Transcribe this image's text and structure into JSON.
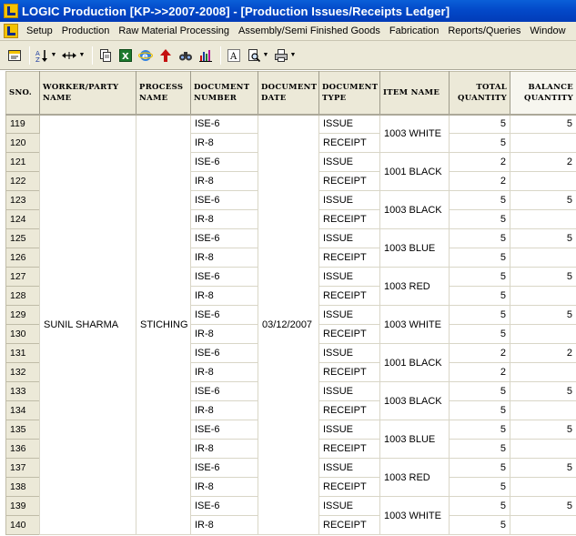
{
  "window": {
    "title": "LOGIC Production  [KP->>2007-2008] - [Production Issues/Receipts Ledger]"
  },
  "menu": {
    "items": [
      "Setup",
      "Production",
      "Raw Material Processing",
      "Assembly/Semi Finished Goods",
      "Fabrication",
      "Reports/Queries",
      "Window"
    ]
  },
  "toolbar": {
    "icons": [
      "form-icon",
      "sort-icon",
      "column-width-icon",
      "copy-icon",
      "excel-icon",
      "browser-icon",
      "upload-arrow-icon",
      "find-icon",
      "chart-icon",
      "font-icon",
      "print-preview-icon",
      "printer-icon"
    ]
  },
  "table": {
    "headers": {
      "sno": "SNO.",
      "worker": "WORKER/PARTY NAME",
      "process": "PROCESS NAME",
      "doc_number": "DOCUMENT NUMBER",
      "doc_date": "DOCUMENT DATE",
      "doc_type": "DOCUMENT TYPE",
      "item_name": "ITEM NAME",
      "total_qty": "TOTAL QUANTITY",
      "balance_qty": "BALANCE QUANTITY"
    },
    "worker": "SUNIL SHARMA",
    "process": "STICHING",
    "doc_date": "03/12/2007",
    "rows": [
      {
        "sno": "119",
        "doc_number": "ISE-6",
        "doc_type": "ISSUE",
        "total": "5",
        "balance": "5"
      },
      {
        "sno": "120",
        "doc_number": "IR-8",
        "doc_type": "RECEIPT",
        "total": "5",
        "balance": ""
      },
      {
        "sno": "121",
        "doc_number": "ISE-6",
        "doc_type": "ISSUE",
        "total": "2",
        "balance": "2"
      },
      {
        "sno": "122",
        "doc_number": "IR-8",
        "doc_type": "RECEIPT",
        "total": "2",
        "balance": ""
      },
      {
        "sno": "123",
        "doc_number": "ISE-6",
        "doc_type": "ISSUE",
        "total": "5",
        "balance": "5"
      },
      {
        "sno": "124",
        "doc_number": "IR-8",
        "doc_type": "RECEIPT",
        "total": "5",
        "balance": ""
      },
      {
        "sno": "125",
        "doc_number": "ISE-6",
        "doc_type": "ISSUE",
        "total": "5",
        "balance": "5"
      },
      {
        "sno": "126",
        "doc_number": "IR-8",
        "doc_type": "RECEIPT",
        "total": "5",
        "balance": ""
      },
      {
        "sno": "127",
        "doc_number": "ISE-6",
        "doc_type": "ISSUE",
        "total": "5",
        "balance": "5"
      },
      {
        "sno": "128",
        "doc_number": "IR-8",
        "doc_type": "RECEIPT",
        "total": "5",
        "balance": ""
      },
      {
        "sno": "129",
        "doc_number": "ISE-6",
        "doc_type": "ISSUE",
        "total": "5",
        "balance": "5"
      },
      {
        "sno": "130",
        "doc_number": "IR-8",
        "doc_type": "RECEIPT",
        "total": "5",
        "balance": ""
      },
      {
        "sno": "131",
        "doc_number": "ISE-6",
        "doc_type": "ISSUE",
        "total": "2",
        "balance": "2"
      },
      {
        "sno": "132",
        "doc_number": "IR-8",
        "doc_type": "RECEIPT",
        "total": "2",
        "balance": ""
      },
      {
        "sno": "133",
        "doc_number": "ISE-6",
        "doc_type": "ISSUE",
        "total": "5",
        "balance": "5"
      },
      {
        "sno": "134",
        "doc_number": "IR-8",
        "doc_type": "RECEIPT",
        "total": "5",
        "balance": ""
      },
      {
        "sno": "135",
        "doc_number": "ISE-6",
        "doc_type": "ISSUE",
        "total": "5",
        "balance": "5"
      },
      {
        "sno": "136",
        "doc_number": "IR-8",
        "doc_type": "RECEIPT",
        "total": "5",
        "balance": ""
      },
      {
        "sno": "137",
        "doc_number": "ISE-6",
        "doc_type": "ISSUE",
        "total": "5",
        "balance": "5"
      },
      {
        "sno": "138",
        "doc_number": "IR-8",
        "doc_type": "RECEIPT",
        "total": "5",
        "balance": ""
      },
      {
        "sno": "139",
        "doc_number": "ISE-6",
        "doc_type": "ISSUE",
        "total": "5",
        "balance": "5"
      },
      {
        "sno": "140",
        "doc_number": "IR-8",
        "doc_type": "RECEIPT",
        "total": "5",
        "balance": ""
      }
    ],
    "item_groups": [
      "1003 WHITE",
      "1001 BLACK",
      "1003 BLACK",
      "1003 BLUE",
      "1003 RED",
      "1003 WHITE",
      "1001 BLACK",
      "1003 BLACK",
      "1003 BLUE",
      "1003 RED",
      "1003 WHITE"
    ]
  }
}
